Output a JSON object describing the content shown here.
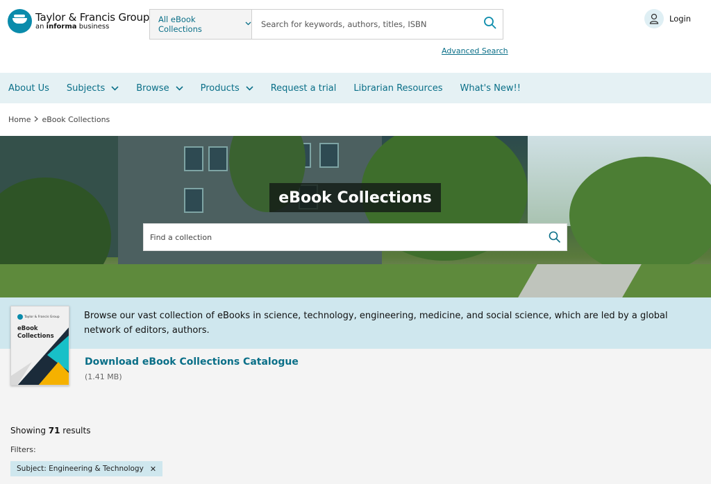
{
  "header": {
    "brand_name": "Taylor & Francis Group",
    "brand_sub_prefix": "an ",
    "brand_sub_bold": "informa",
    "brand_sub_suffix": " business",
    "search_scope": "All eBook Collections",
    "search_placeholder": "Search for keywords, authors, titles, ISBN",
    "advanced_search": "Advanced Search",
    "login": "Login"
  },
  "nav": {
    "items": [
      {
        "label": "About Us",
        "has_dropdown": false
      },
      {
        "label": "Subjects",
        "has_dropdown": true
      },
      {
        "label": "Browse",
        "has_dropdown": true
      },
      {
        "label": "Products",
        "has_dropdown": true
      },
      {
        "label": "Request a trial",
        "has_dropdown": false
      },
      {
        "label": "Librarian Resources",
        "has_dropdown": false
      },
      {
        "label": "What's New!!",
        "has_dropdown": false
      }
    ]
  },
  "breadcrumb": {
    "home": "Home",
    "current": "eBook Collections"
  },
  "hero": {
    "title": "eBook Collections",
    "search_placeholder": "Find a collection"
  },
  "intro": {
    "text": "Browse our vast collection of eBooks in science, technology, engineering, medicine, and social science, which are led by a global network of editors, authors.",
    "cover_brand": "Taylor & Francis Group",
    "cover_title_line1": "eBook",
    "cover_title_line2": "Collections",
    "download_label": "Download eBook Collections Catalogue",
    "file_size": "(1.41 MB)"
  },
  "results": {
    "showing_prefix": "Showing ",
    "count": "71",
    "showing_suffix": " results",
    "filters_label": "Filters:",
    "active_filters": [
      "Subject: Engineering & Technology"
    ]
  },
  "colors": {
    "accent": "#0a6f88",
    "nav_background": "#e5f1f4",
    "intro_background": "#cfe7ee"
  }
}
